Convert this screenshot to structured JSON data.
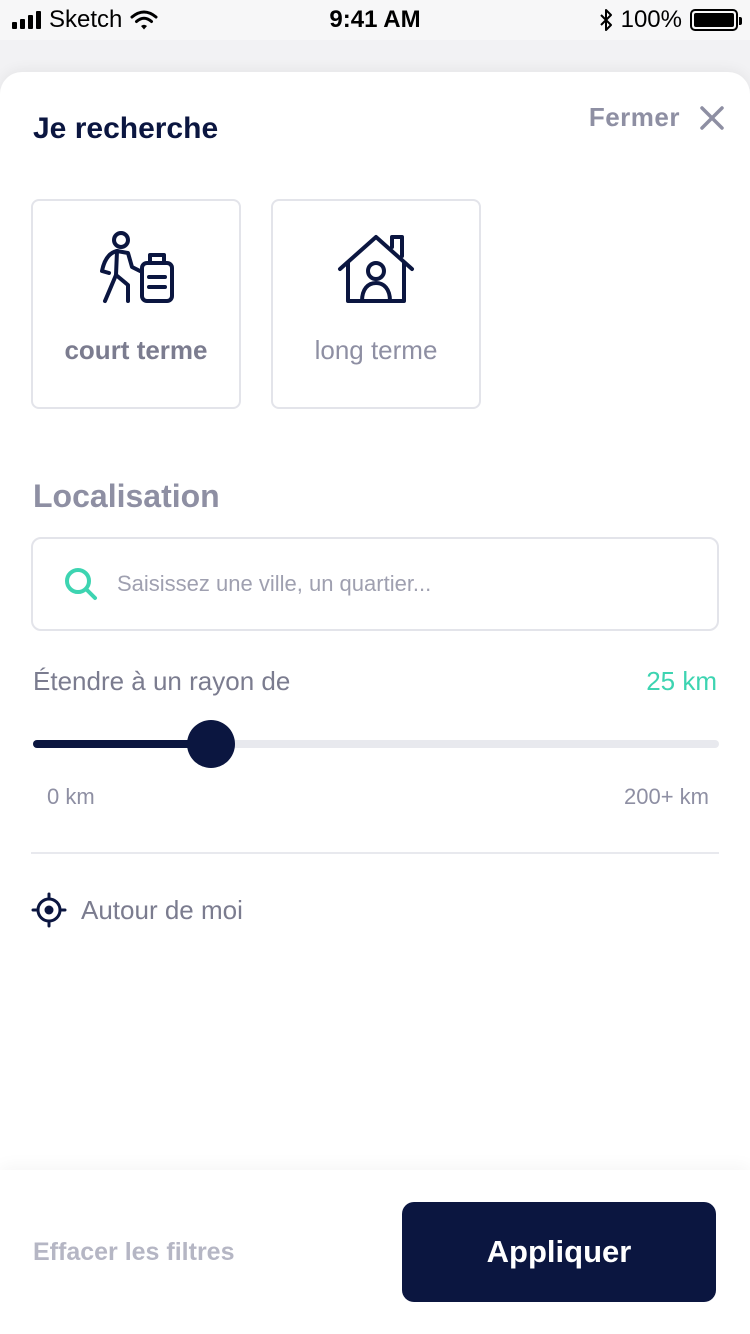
{
  "status_bar": {
    "carrier": "Sketch",
    "time": "9:41 AM",
    "battery": "100%"
  },
  "header": {
    "title": "Je recherche",
    "close_label": "Fermer"
  },
  "search_types": [
    {
      "label": "court terme",
      "icon": "traveler-luggage-icon",
      "selected": true
    },
    {
      "label": "long terme",
      "icon": "house-person-icon",
      "selected": false
    }
  ],
  "location": {
    "section_title": "Localisation",
    "search_placeholder": "Saisissez une ville, un quartier...",
    "search_value": "",
    "radius_label": "Étendre à un rayon de",
    "radius_value": "25 km",
    "radius_fraction": 0.26,
    "slider_min": "0 km",
    "slider_max": "200+ km",
    "around_me_label": "Autour de moi"
  },
  "footer": {
    "clear_label": "Effacer les filtres",
    "apply_label": "Appliquer"
  },
  "colors": {
    "primary": "#0b1640",
    "accent": "#3dd4b1",
    "muted": "#8e8fa3"
  }
}
